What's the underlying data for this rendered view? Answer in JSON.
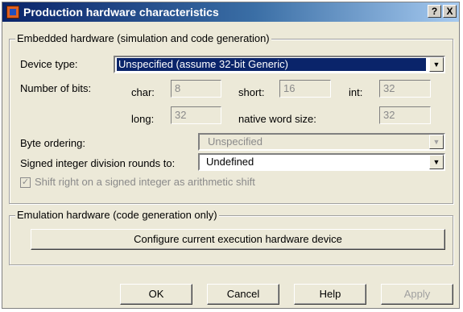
{
  "window": {
    "title": "Production hardware characteristics",
    "help_btn": "?",
    "close_btn": "X"
  },
  "embedded": {
    "legend": "Embedded hardware (simulation and code generation)",
    "device_type_label": "Device type:",
    "device_type_value": "Unspecified (assume 32-bit Generic)",
    "number_of_bits_label": "Number of bits:",
    "char_label": "char:",
    "char_value": "8",
    "short_label": "short:",
    "short_value": "16",
    "int_label": "int:",
    "int_value": "32",
    "long_label": "long:",
    "long_value": "32",
    "native_label": "native word size:",
    "native_value": "32",
    "byte_ordering_label": "Byte ordering:",
    "byte_ordering_value": "Unspecified",
    "division_label": "Signed integer division rounds to:",
    "division_value": "Undefined",
    "shift_label": "Shift right on a signed integer as arithmetic shift",
    "shift_checked": true
  },
  "emulation": {
    "legend": "Emulation hardware (code generation only)",
    "configure_button": "Configure current execution hardware device"
  },
  "buttons": {
    "ok": "OK",
    "cancel": "Cancel",
    "help": "Help",
    "apply": "Apply"
  },
  "colors": {
    "dialog_bg": "#ece9d8",
    "title_start": "#0a246a",
    "title_end": "#a6caf0",
    "selection": "#0a246a",
    "disabled_text": "#8a8a8a"
  }
}
